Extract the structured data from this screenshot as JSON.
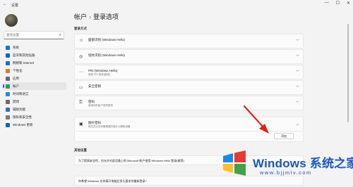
{
  "window": {
    "app_title": "设置",
    "back_glyph": "←",
    "min_glyph": "—",
    "max_glyph": "☐",
    "close_glyph": "✕"
  },
  "sidebar": {
    "search_placeholder": "查找设置",
    "items": [
      {
        "label": "系统",
        "icon": "system-icon",
        "color": "#0078d4"
      },
      {
        "label": "蓝牙和其他设备",
        "icon": "bluetooth-icon",
        "color": "#0067c0"
      },
      {
        "label": "网络和 Internet",
        "icon": "network-icon",
        "color": "#1c6fc9"
      },
      {
        "label": "个性化",
        "icon": "personalization-icon",
        "color": "#d17d2f"
      },
      {
        "label": "应用",
        "icon": "apps-icon",
        "color": "#5b6b7a"
      },
      {
        "label": "帐户",
        "icon": "accounts-icon",
        "color": "#2d9a5a",
        "active": true
      },
      {
        "label": "时间和语言",
        "icon": "time-language-icon",
        "color": "#2b88d8"
      },
      {
        "label": "游戏",
        "icon": "gaming-icon",
        "color": "#6b6b6b"
      },
      {
        "label": "辅助功能",
        "icon": "accessibility-icon",
        "color": "#3a6bb0"
      },
      {
        "label": "隐私和安全性",
        "icon": "privacy-icon",
        "color": "#7a7a7a"
      },
      {
        "label": "Windows 更新",
        "icon": "update-icon",
        "color": "#0067c0"
      }
    ]
  },
  "main": {
    "breadcrumb_parent": "帐户",
    "breadcrumb_sep": "›",
    "breadcrumb_current": "登录选项",
    "section_signin": "登录方式",
    "options": [
      {
        "title": "面部识别 (Windows Hello)",
        "subtitle": "",
        "icon": "face-icon",
        "glyph": "☺"
      },
      {
        "title": "指纹识别 (Windows Hello)",
        "subtitle": "",
        "icon": "fingerprint-icon",
        "glyph": "◎"
      },
      {
        "title": "PIN (Windows Hello)",
        "subtitle": "使用 PIN 登录(推荐)",
        "icon": "pin-icon",
        "glyph": "⋯"
      },
      {
        "title": "安全密钥",
        "subtitle": "",
        "icon": "security-key-icon",
        "glyph": "▭"
      },
      {
        "title": "密码",
        "subtitle": "使用你的帐户密码登录",
        "icon": "password-icon",
        "glyph": "⚿"
      },
      {
        "title": "图片密码",
        "subtitle": "轻扫并点击你最喜爱的照片以解锁设备",
        "icon": "picture-password-icon",
        "glyph": "▣"
      }
    ],
    "add_button": "添加",
    "section_extra": "其他设置",
    "related": [
      "为了提高安全性，仅允许对此设备上的 Microsoft 帐户使用 Windows Hello 登录(推荐)",
      "你希望 Windows 在你离开电脑后多久要求你重新登录?"
    ]
  },
  "watermark": {
    "brand": "Windows 系统之家",
    "url": "www.bjjmlv.com"
  },
  "colors": {
    "accent": "#0067c0",
    "arrow": "#e0211b"
  }
}
